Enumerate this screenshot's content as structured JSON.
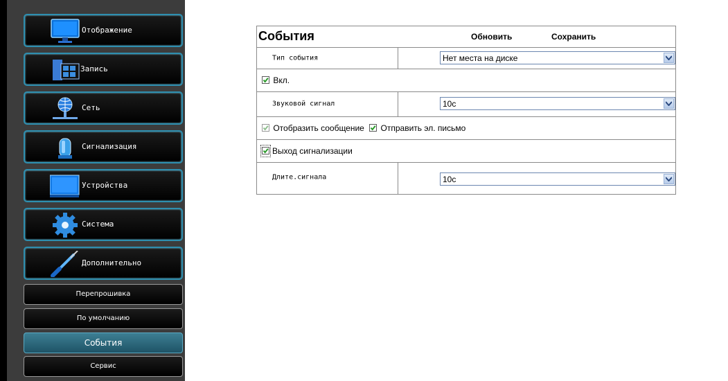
{
  "sidebar": {
    "nav": [
      {
        "label": "Отображение",
        "icon": "monitor-icon"
      },
      {
        "label": "Запись",
        "icon": "film-icon"
      },
      {
        "label": "Сеть",
        "icon": "globe-network-icon"
      },
      {
        "label": "Сигнализация",
        "icon": "alarm-siren-icon"
      },
      {
        "label": "Устройства",
        "icon": "display-device-icon"
      },
      {
        "label": "Система",
        "icon": "gear-icon"
      },
      {
        "label": "Дополнительно",
        "icon": "screwdriver-icon"
      }
    ],
    "sub": [
      {
        "label": "Перепрошивка"
      },
      {
        "label": "По умолчанию"
      },
      {
        "label": "События",
        "active": true
      },
      {
        "label": "Сервис"
      }
    ]
  },
  "panel": {
    "title": "События",
    "refresh_label": "Обновить",
    "save_label": "Сохранить",
    "event_type_label": "Тип события",
    "event_type_value": "Нет места на диске",
    "enable_label": "Вкл.",
    "enable_checked": true,
    "beep_label": "Звуковой сигнал",
    "beep_value": "10с",
    "show_message_label": "Отобразить сообщение",
    "show_message_checked": true,
    "send_email_label": "Отправить эл. письмо",
    "send_email_checked": true,
    "alarm_out_label": "Выход сигнализации",
    "alarm_out_checked": true,
    "duration_label": "Длите.сигнала",
    "duration_value": "10с"
  },
  "colors": {
    "nav_border": "#2e8fb0",
    "active_sub": "#2f6f83",
    "check_green": "#2a9a2a"
  }
}
